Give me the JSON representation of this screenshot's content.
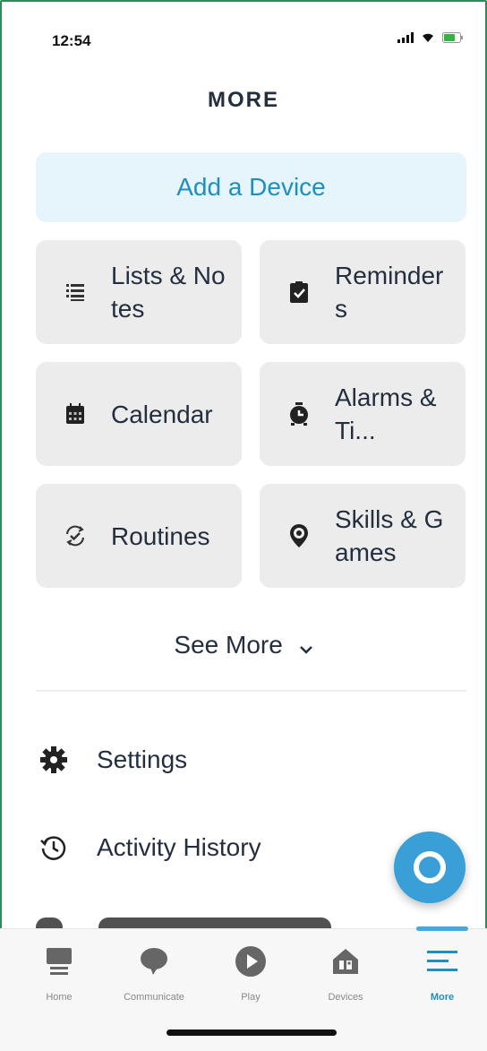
{
  "status_bar": {
    "time": "12:54"
  },
  "header": {
    "title": "MORE"
  },
  "add_device": {
    "label": "Add a Device"
  },
  "tiles": [
    {
      "label": "Lists & Notes",
      "icon": "list-icon"
    },
    {
      "label": "Reminders",
      "icon": "clipboard-check-icon"
    },
    {
      "label": "Calendar",
      "icon": "calendar-icon"
    },
    {
      "label": "Alarms & Ti...",
      "icon": "alarm-clock-icon"
    },
    {
      "label": "Routines",
      "icon": "routine-check-icon"
    },
    {
      "label": "Skills & Games",
      "icon": "location-pin-icon"
    }
  ],
  "see_more": {
    "label": "See More"
  },
  "menu": [
    {
      "label": "Settings",
      "icon": "gear-icon"
    },
    {
      "label": "Activity History",
      "icon": "history-clock-icon"
    }
  ],
  "tabbar": {
    "tabs": [
      {
        "label": "Home",
        "icon": "home-icon"
      },
      {
        "label": "Communicate",
        "icon": "chat-bubble-icon"
      },
      {
        "label": "Play",
        "icon": "play-icon"
      },
      {
        "label": "Devices",
        "icon": "devices-house-icon"
      },
      {
        "label": "More",
        "icon": "hamburger-menu-icon"
      }
    ],
    "active_index": 4
  },
  "colors": {
    "accent": "#1f8fbf",
    "alexa_button": "#3a9fd6",
    "tile_bg": "#ececec",
    "add_device_bg": "#e6f4fb"
  }
}
